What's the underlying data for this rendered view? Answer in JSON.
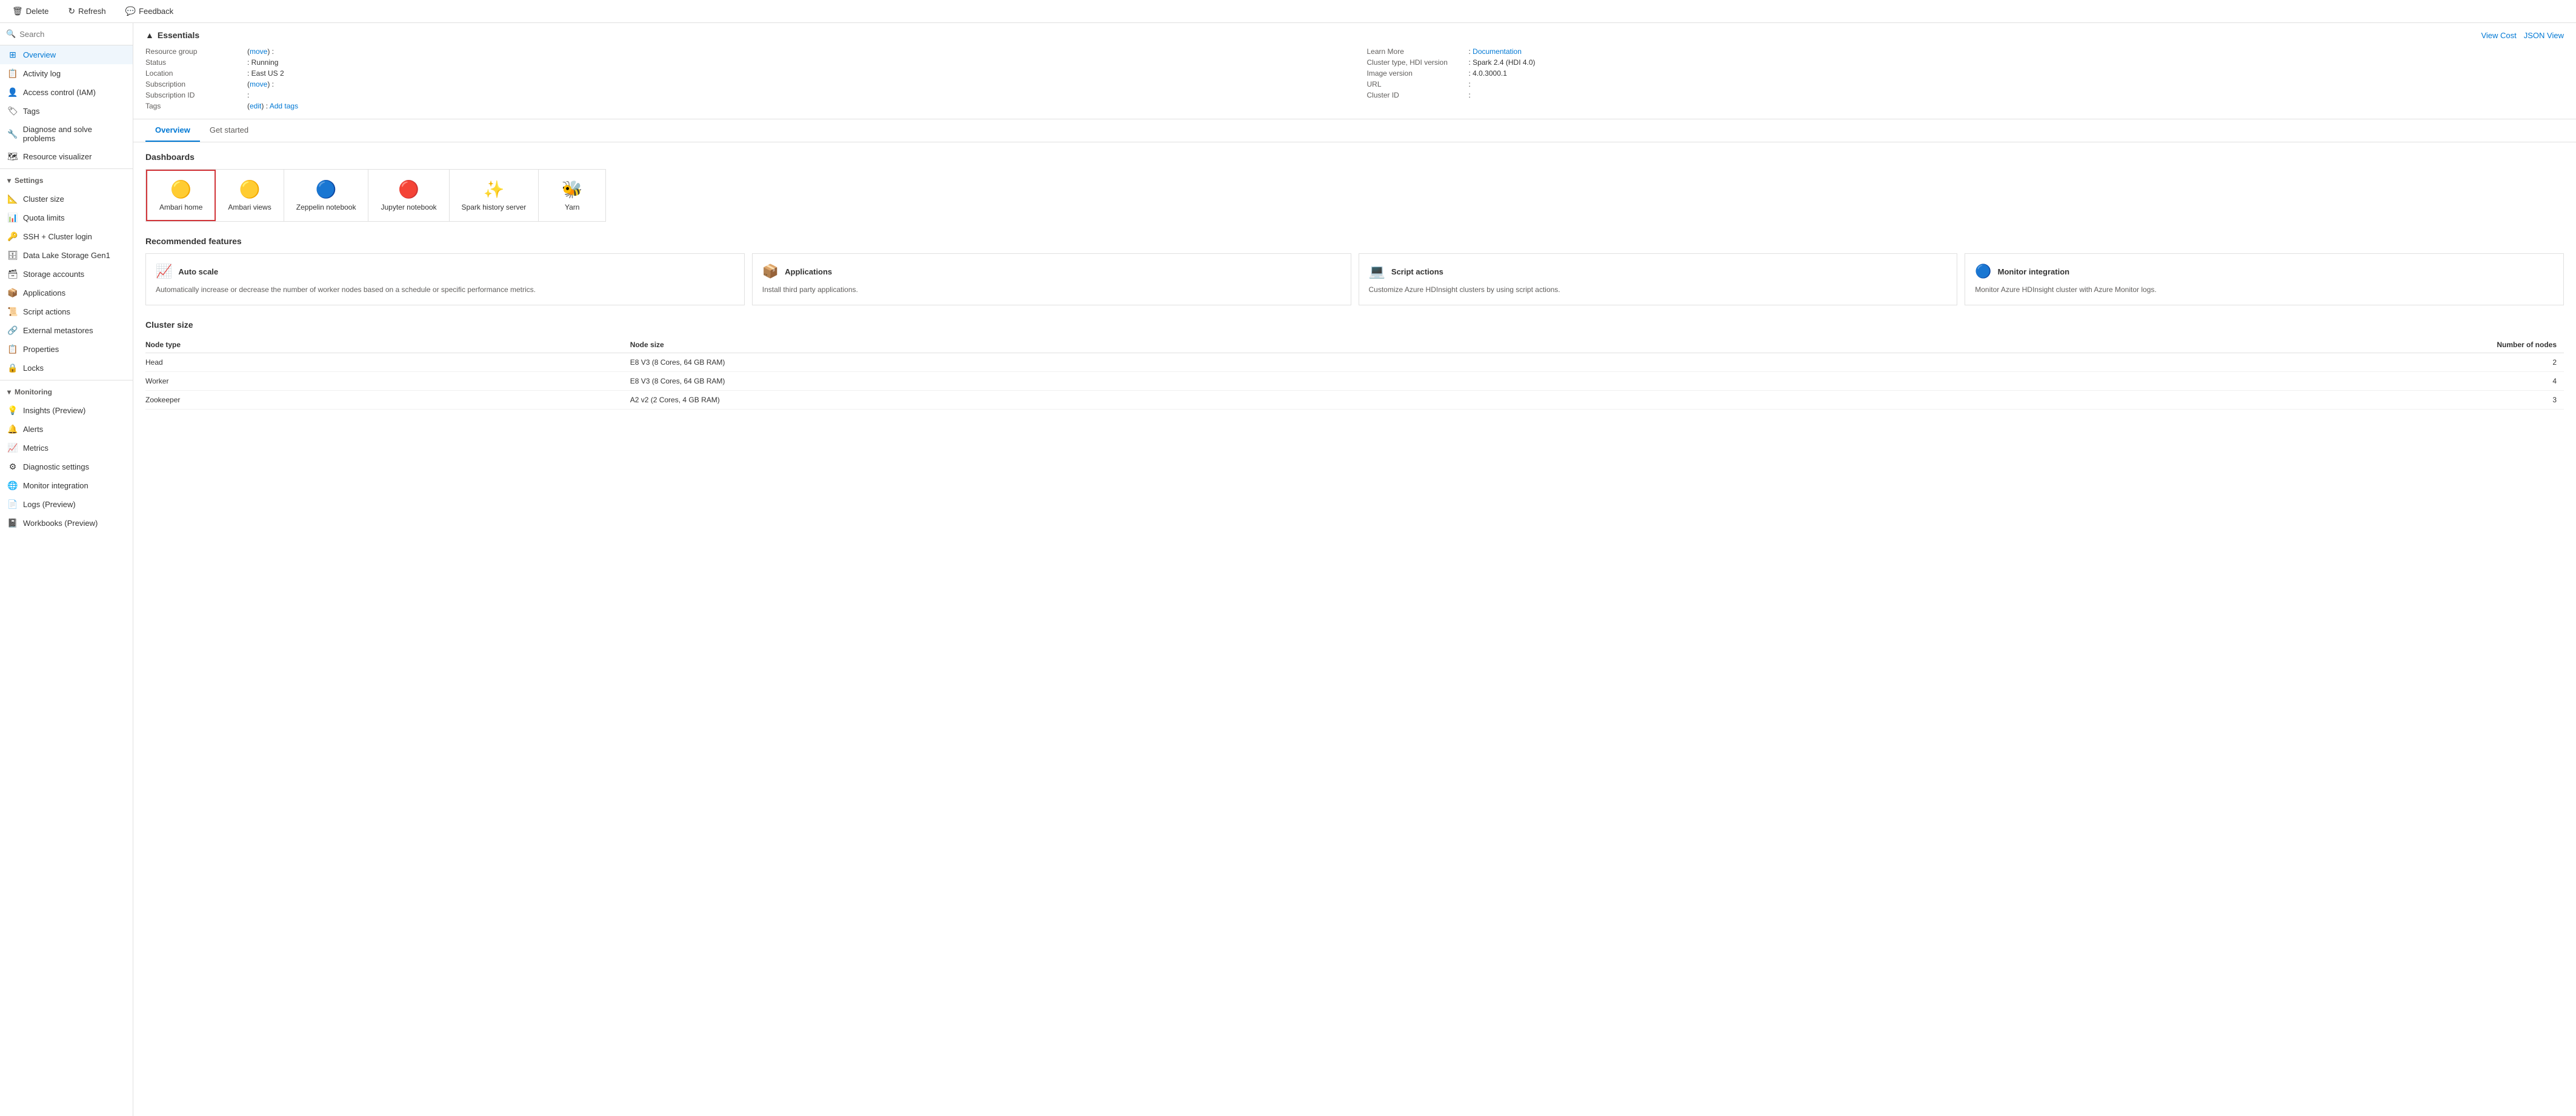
{
  "toolbar": {
    "delete_label": "Delete",
    "refresh_label": "Refresh",
    "feedback_label": "Feedback"
  },
  "sidebar": {
    "search_placeholder": "Search",
    "items": [
      {
        "id": "overview",
        "label": "Overview",
        "icon": "⊞",
        "active": true
      },
      {
        "id": "activity-log",
        "label": "Activity log",
        "icon": "📋"
      },
      {
        "id": "access-control",
        "label": "Access control (IAM)",
        "icon": "👤"
      },
      {
        "id": "tags",
        "label": "Tags",
        "icon": "🏷"
      },
      {
        "id": "diagnose",
        "label": "Diagnose and solve problems",
        "icon": "🔧"
      },
      {
        "id": "resource-visualizer",
        "label": "Resource visualizer",
        "icon": "🗺"
      }
    ],
    "sections": [
      {
        "id": "settings",
        "label": "Settings",
        "items": [
          {
            "id": "cluster-size",
            "label": "Cluster size",
            "icon": "📐"
          },
          {
            "id": "quota-limits",
            "label": "Quota limits",
            "icon": "📊"
          },
          {
            "id": "ssh-cluster-login",
            "label": "SSH + Cluster login",
            "icon": "🔑"
          },
          {
            "id": "data-lake-storage",
            "label": "Data Lake Storage Gen1",
            "icon": "🗄"
          },
          {
            "id": "storage-accounts",
            "label": "Storage accounts",
            "icon": "🗃"
          },
          {
            "id": "applications",
            "label": "Applications",
            "icon": "📦"
          },
          {
            "id": "script-actions",
            "label": "Script actions",
            "icon": "📜"
          },
          {
            "id": "external-metastores",
            "label": "External metastores",
            "icon": "🔗"
          },
          {
            "id": "properties",
            "label": "Properties",
            "icon": "📋"
          },
          {
            "id": "locks",
            "label": "Locks",
            "icon": "🔒"
          }
        ]
      },
      {
        "id": "monitoring",
        "label": "Monitoring",
        "items": [
          {
            "id": "insights-preview",
            "label": "Insights (Preview)",
            "icon": "💡"
          },
          {
            "id": "alerts",
            "label": "Alerts",
            "icon": "🔔"
          },
          {
            "id": "metrics",
            "label": "Metrics",
            "icon": "📈"
          },
          {
            "id": "diagnostic-settings",
            "label": "Diagnostic settings",
            "icon": "⚙"
          },
          {
            "id": "monitor-integration",
            "label": "Monitor integration",
            "icon": "🌐"
          },
          {
            "id": "logs-preview",
            "label": "Logs (Preview)",
            "icon": "📄"
          },
          {
            "id": "workbooks-preview",
            "label": "Workbooks (Preview)",
            "icon": "📓"
          }
        ]
      }
    ]
  },
  "essentials": {
    "header": "Essentials",
    "view_cost_label": "View Cost",
    "json_view_label": "JSON View",
    "fields_left": [
      {
        "label": "Resource group",
        "value": "",
        "link": "move",
        "has_link": true
      },
      {
        "label": "Status",
        "value": "Running"
      },
      {
        "label": "Location",
        "value": "East US 2"
      },
      {
        "label": "Subscription",
        "value": "",
        "link": "move",
        "has_link": true
      },
      {
        "label": "Subscription ID",
        "value": ""
      },
      {
        "label": "Tags",
        "value": "",
        "edit_link": "edit",
        "add_link": "Add tags"
      }
    ],
    "fields_right": [
      {
        "label": "Learn More",
        "value": "Documentation",
        "is_link": true
      },
      {
        "label": "Cluster type, HDI version",
        "value": "Spark 2.4 (HDI 4.0)"
      },
      {
        "label": "Image version",
        "value": "4.0.3000.1"
      },
      {
        "label": "URL",
        "value": ""
      },
      {
        "label": "Cluster ID",
        "value": ""
      }
    ]
  },
  "tabs": [
    {
      "id": "overview",
      "label": "Overview",
      "active": true
    },
    {
      "id": "get-started",
      "label": "Get started",
      "active": false
    }
  ],
  "overview": {
    "dashboards_title": "Dashboards",
    "dashboards": [
      {
        "id": "ambari-home",
        "label": "Ambari home",
        "icon": "🟡",
        "highlighted": true
      },
      {
        "id": "ambari-views",
        "label": "Ambari views",
        "icon": "🟡",
        "highlighted": false
      },
      {
        "id": "zeppelin-notebook",
        "label": "Zeppelin notebook",
        "icon": "🔵",
        "highlighted": false
      },
      {
        "id": "jupyter-notebook",
        "label": "Jupyter notebook",
        "icon": "🔴",
        "highlighted": false
      },
      {
        "id": "spark-history-server",
        "label": "Spark history server",
        "icon": "✨",
        "highlighted": false
      },
      {
        "id": "yarn",
        "label": "Yarn",
        "icon": "🐝",
        "highlighted": false
      }
    ],
    "recommended_title": "Recommended features",
    "features": [
      {
        "id": "auto-scale",
        "title": "Auto scale",
        "icon": "📈",
        "desc": "Automatically increase or decrease the number of worker nodes based on a schedule or specific performance metrics."
      },
      {
        "id": "applications",
        "title": "Applications",
        "icon": "📦",
        "desc": "Install third party applications."
      },
      {
        "id": "script-actions",
        "title": "Script actions",
        "icon": "💻",
        "desc": "Customize Azure HDInsight clusters by using script actions."
      },
      {
        "id": "monitor-integration",
        "title": "Monitor integration",
        "icon": "🔵",
        "desc": "Monitor Azure HDInsight cluster with Azure Monitor logs."
      }
    ],
    "cluster_size_title": "Cluster size",
    "cluster_table": {
      "headers": [
        "Node type",
        "Node size",
        "Number of nodes"
      ],
      "rows": [
        {
          "node_type": "Head",
          "node_size": "E8 V3 (8 Cores, 64 GB RAM)",
          "node_count": "2"
        },
        {
          "node_type": "Worker",
          "node_size": "E8 V3 (8 Cores, 64 GB RAM)",
          "node_count": "4"
        },
        {
          "node_type": "Zookeeper",
          "node_size": "A2 v2 (2 Cores, 4 GB RAM)",
          "node_count": "3"
        }
      ]
    }
  }
}
